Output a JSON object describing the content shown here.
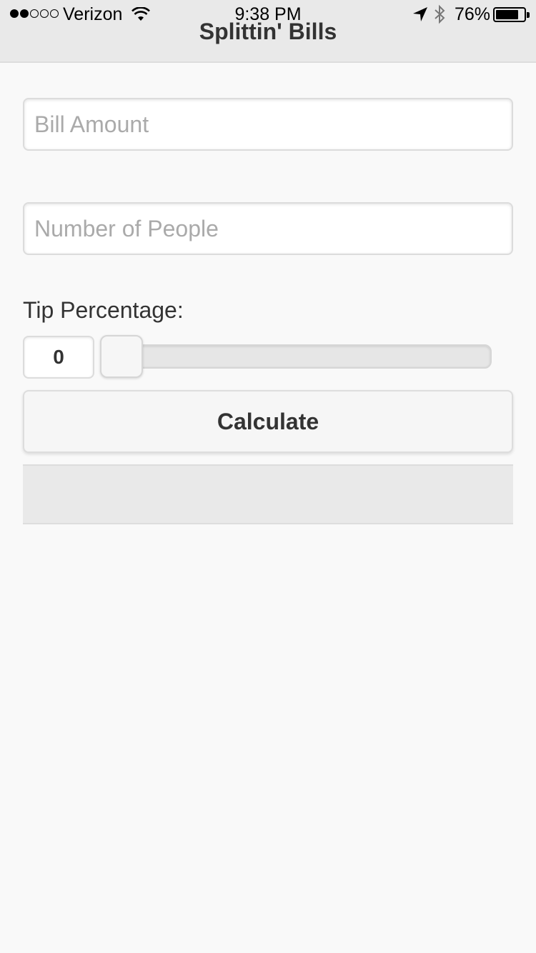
{
  "status_bar": {
    "carrier": "Verizon",
    "time": "9:38 PM",
    "battery_percent": "76%",
    "battery_level": 0.76,
    "signal_bars_filled": 2,
    "signal_bars_total": 5
  },
  "header": {
    "title": "Splittin' Bills"
  },
  "form": {
    "bill_amount": {
      "placeholder": "Bill Amount",
      "value": ""
    },
    "num_people": {
      "placeholder": "Number of People",
      "value": ""
    },
    "tip": {
      "label": "Tip Percentage:",
      "value": "0",
      "slider_value": 0
    },
    "calculate_label": "Calculate"
  },
  "result": {
    "text": ""
  },
  "icons": [
    "wifi-icon",
    "location-arrow-icon",
    "bluetooth-icon",
    "battery-icon"
  ],
  "colors": {
    "header_bg": "#e9e9e9",
    "page_bg": "#f9f9f9",
    "text": "#333333",
    "placeholder": "#aaaaaa"
  }
}
